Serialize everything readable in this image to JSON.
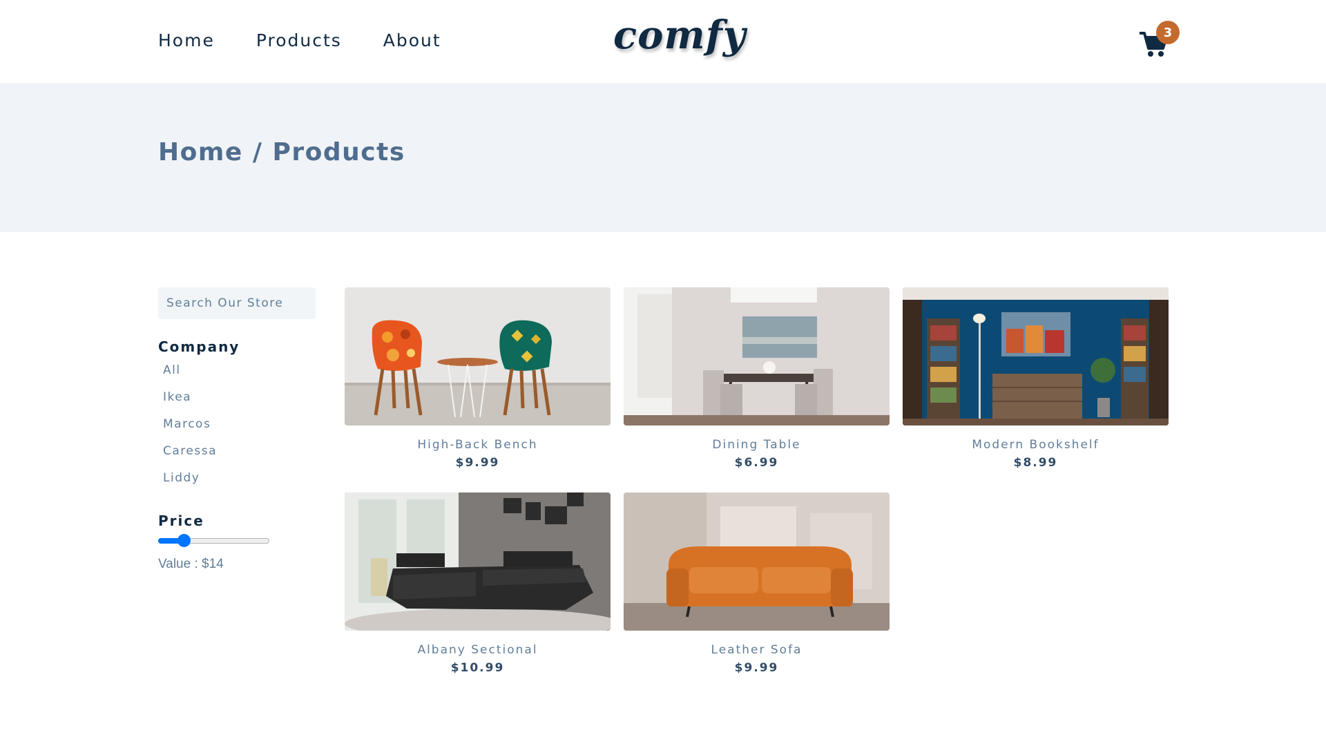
{
  "nav": {
    "links": [
      "Home",
      "Products",
      "About"
    ],
    "logo": "comfy",
    "cart_count": "3"
  },
  "hero": {
    "breadcrumb": "Home / Products"
  },
  "sidebar": {
    "search_placeholder": "Search Our Store",
    "company_title": "Company",
    "companies": [
      "All",
      "Ikea",
      "Marcos",
      "Caressa",
      "Liddy"
    ],
    "price_title": "Price",
    "price_value_text": "Value : $14",
    "price_fraction": 0.2
  },
  "products": [
    {
      "name": "High-Back Bench",
      "price": "$9.99"
    },
    {
      "name": "Dining Table",
      "price": "$6.99"
    },
    {
      "name": "Modern Bookshelf",
      "price": "$8.99"
    },
    {
      "name": "Albany Sectional",
      "price": "$10.99"
    },
    {
      "name": "Leather Sofa",
      "price": "$9.99"
    }
  ],
  "colors": {
    "primary": "#102a42",
    "muted": "#617d98",
    "accent": "#c36a2d",
    "hero_bg": "#f0f4f8",
    "slider": "#0075ff"
  }
}
